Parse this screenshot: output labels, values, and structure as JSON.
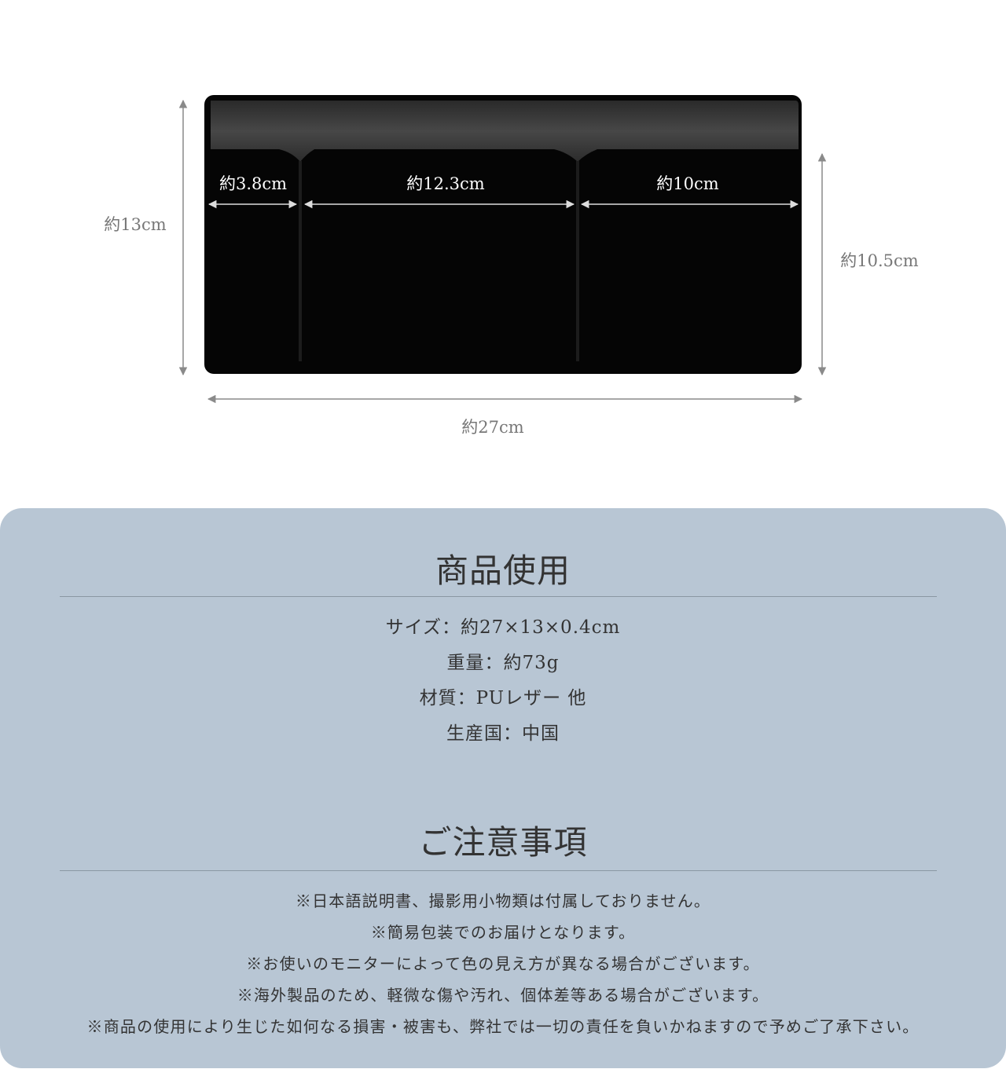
{
  "diagram": {
    "height_label": "約13cm",
    "pocket_height_label": "約10.5cm",
    "width_label": "約27cm",
    "pockets": [
      {
        "label": "約3.8cm"
      },
      {
        "label": "約12.3cm"
      },
      {
        "label": "約10cm"
      }
    ],
    "colors": {
      "body": "#050505",
      "band": "#3a3a3a",
      "arrow": "#8a8a8a"
    }
  },
  "specs": {
    "title": "商品使用",
    "items": [
      "サイズ：約27×13×0.4cm",
      "重量：約73g",
      "材質：PUレザー 他",
      "生産国：中国"
    ]
  },
  "notices": {
    "title": "ご注意事項",
    "items": [
      "※日本語説明書、撮影用小物類は付属しておりません。",
      "※簡易包装でのお届けとなります。",
      "※お使いのモニターによって色の見え方が異なる場合がございます。",
      "※海外製品のため、軽微な傷や汚れ、個体差等ある場合がございます。",
      "※商品の使用により生じた如何なる損害・被害も、弊社では一切の責任を負いかねますので予めご了承下さい。"
    ]
  },
  "panel_color": "#b8c6d4"
}
